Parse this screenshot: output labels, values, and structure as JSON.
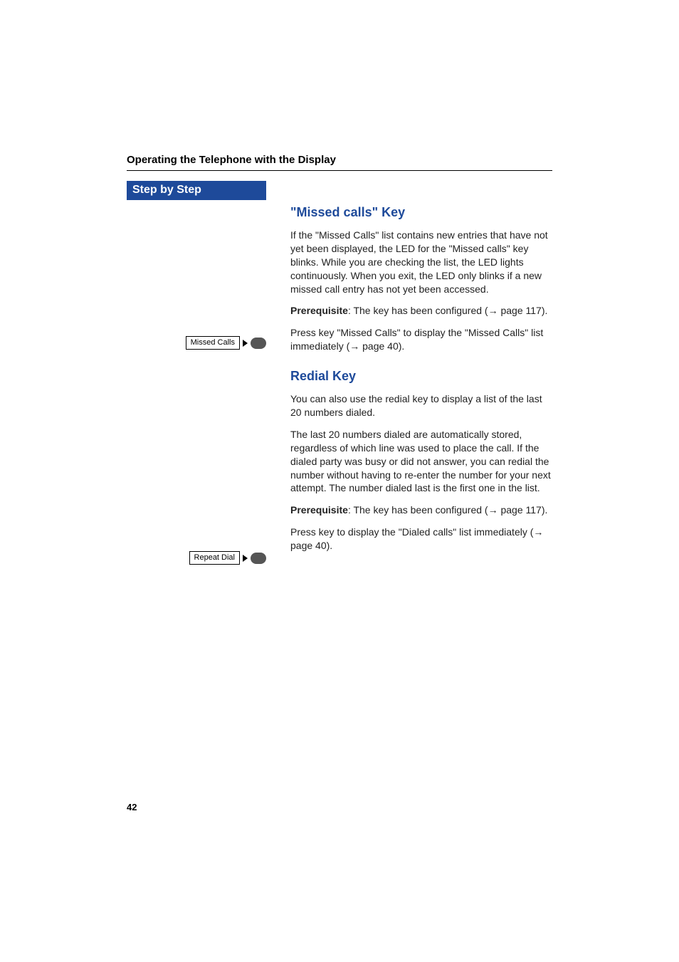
{
  "header": {
    "section_title": "Operating the Telephone with the Display"
  },
  "left_rail": {
    "step_banner": "Step by Step",
    "keys": {
      "missed_calls_label": "Missed Calls",
      "repeat_dial_label": "Repeat Dial"
    }
  },
  "main": {
    "missed": {
      "heading": "\"Missed calls\" Key",
      "para1": "If the \"Missed Calls\" list contains new entries that have not yet been displayed, the LED for the \"Missed calls\" key blinks. While you are checking the list, the LED lights continuously. When you exit, the LED only blinks if a new missed call entry has not yet been accessed.",
      "prereq_label": "Prerequisite",
      "prereq_text": ": The key has been configured (→ page 117).",
      "press_text": "Press key \"Missed Calls\" to display the \"Missed Calls\" list immediately (→ page 40)."
    },
    "redial": {
      "heading": "Redial Key",
      "para1": "You can also use the redial key to display a list of the last 20 numbers dialed.",
      "para2": "The last 20 numbers dialed are automatically stored, regardless of which line was used to place the call. If the dialed party was busy or did not answer, you can redial the number without having to re-enter the number for your next attempt. The number dialed last is the first one in the list.",
      "prereq_label": "Prerequisite",
      "prereq_text": ": The key has been configured (→ page 117).",
      "press_text": "Press key to display the \"Dialed calls\" list immediately (→ page 40)."
    }
  },
  "page_number": "42"
}
